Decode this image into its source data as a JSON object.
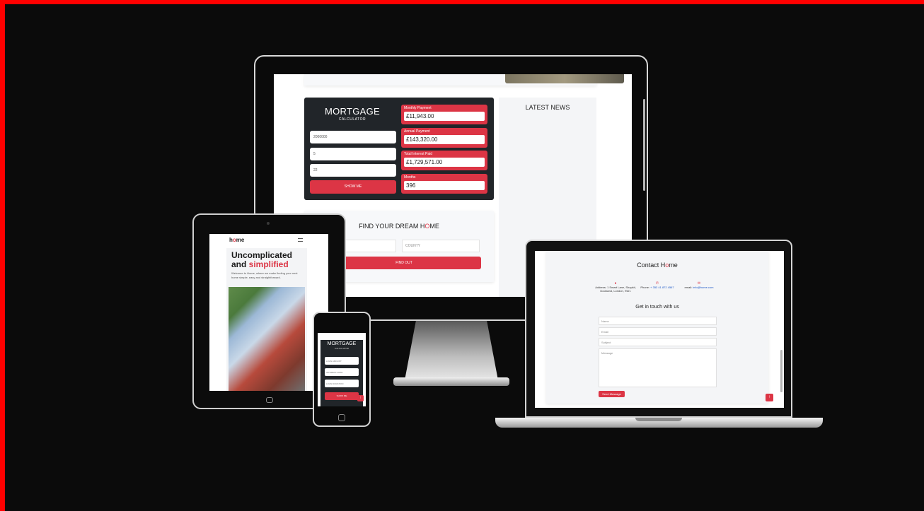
{
  "desktop": {
    "calculator": {
      "title": "MORTGAGE",
      "subtitle": "CALCULATOR",
      "inputs": [
        "2000000",
        "5",
        "22"
      ],
      "button": "SHOW ME",
      "results": [
        {
          "label": "Monthly Payment",
          "value": "£11,943.00"
        },
        {
          "label": "Annual Payment",
          "value": "£143,320.00"
        },
        {
          "label": "Total Interest Paid",
          "value": "£1,729,571.00"
        },
        {
          "label": "Months",
          "value": "396"
        }
      ]
    },
    "news": {
      "title": "LATEST NEWS"
    },
    "dream": {
      "title_start": "FIND YOUR DREAM H",
      "title_o": "O",
      "title_end": "ME",
      "town_placeholder": "TOWN",
      "county_placeholder": "COUNTY",
      "button": "FIND OUT"
    }
  },
  "tablet": {
    "logo_h": "h",
    "logo_o": "o",
    "logo_me": "me",
    "hero_line1": "Uncomplicated",
    "hero_and": "and ",
    "hero_red": "simplified",
    "hero_text": "Welcome to Home, where we make finding your next home simple, easy and straightforward."
  },
  "phone": {
    "title": "MORTGAGE",
    "subtitle": "CALCULATOR",
    "inputs": [
      "LOAN AMOUNT",
      "INTEREST RATE",
      "LOAN DURATION"
    ],
    "button": "SHOW ME",
    "fab": "↑"
  },
  "laptop": {
    "title_start": "Contact H",
    "title_o": "o",
    "title_end": "me",
    "address": "Address: 1 Smart Lane, Shopkit, Dockland, London, SW1",
    "phone_label": "Phone: ",
    "phone_link": "+ 353 41 872 4567",
    "email_label": "email: ",
    "email_link": "info@home.com",
    "get_in_touch": "Get in touch with us",
    "fields": [
      "Name",
      "Email",
      "Subject"
    ],
    "message_placeholder": "Message",
    "send": "Send Message",
    "fab": "↑"
  },
  "colors": {
    "accent": "#dc3545",
    "dark_panel": "#212529",
    "background": "#0b0b0b",
    "frame": "#ff0000"
  }
}
